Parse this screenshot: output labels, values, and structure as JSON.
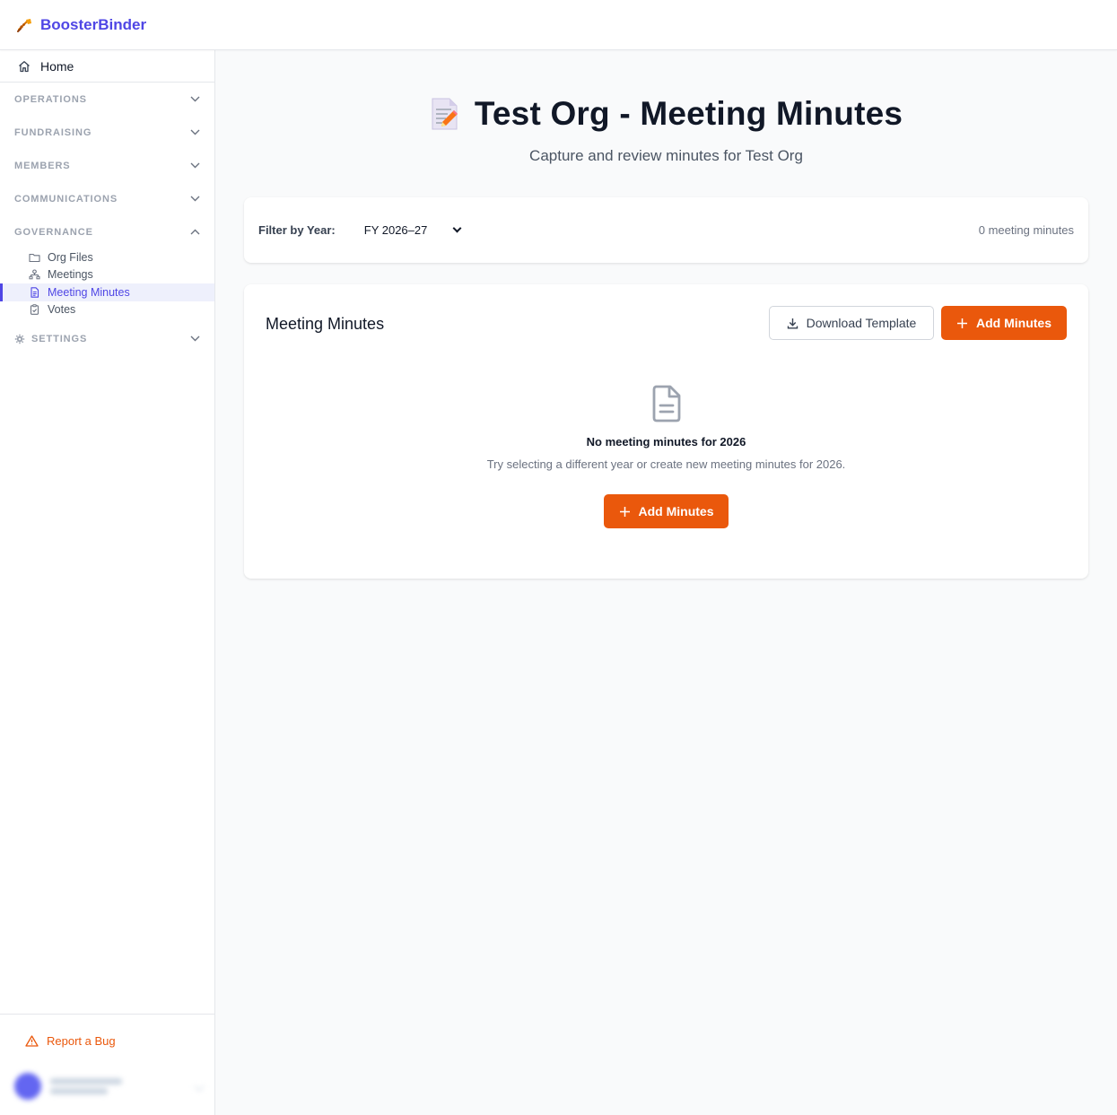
{
  "app": {
    "brand": "BoosterBinder"
  },
  "sidebar": {
    "home": "Home",
    "sections": {
      "operations": "OPERATIONS",
      "fundraising": "FUNDRAISING",
      "members": "MEMBERS",
      "communications": "COMMUNICATIONS",
      "governance": "GOVERNANCE",
      "settings": "SETTINGS"
    },
    "governance_items": {
      "org_files": "Org Files",
      "meetings": "Meetings",
      "meeting_minutes": "Meeting Minutes",
      "votes": "Votes"
    },
    "active_item": "Meeting Minutes",
    "report_bug": "Report a Bug"
  },
  "page": {
    "title": "Test Org - Meeting Minutes",
    "subtitle": "Capture and review minutes for Test Org",
    "emoji_icon": "memo-icon"
  },
  "filter": {
    "label": "Filter by Year:",
    "selected_year": "FY 2026–27",
    "count_text": "0 meeting minutes"
  },
  "minutes": {
    "section_title": "Meeting Minutes",
    "download_template_label": "Download Template",
    "add_minutes_label": "Add Minutes",
    "empty_title": "No meeting minutes for 2026",
    "empty_description": "Try selecting a different year or create new meeting minutes for 2026.",
    "empty_add_label": "Add Minutes"
  },
  "colors": {
    "brand": "#4f46e5",
    "accent": "#ea580c",
    "active_bg": "#eef0fc"
  }
}
